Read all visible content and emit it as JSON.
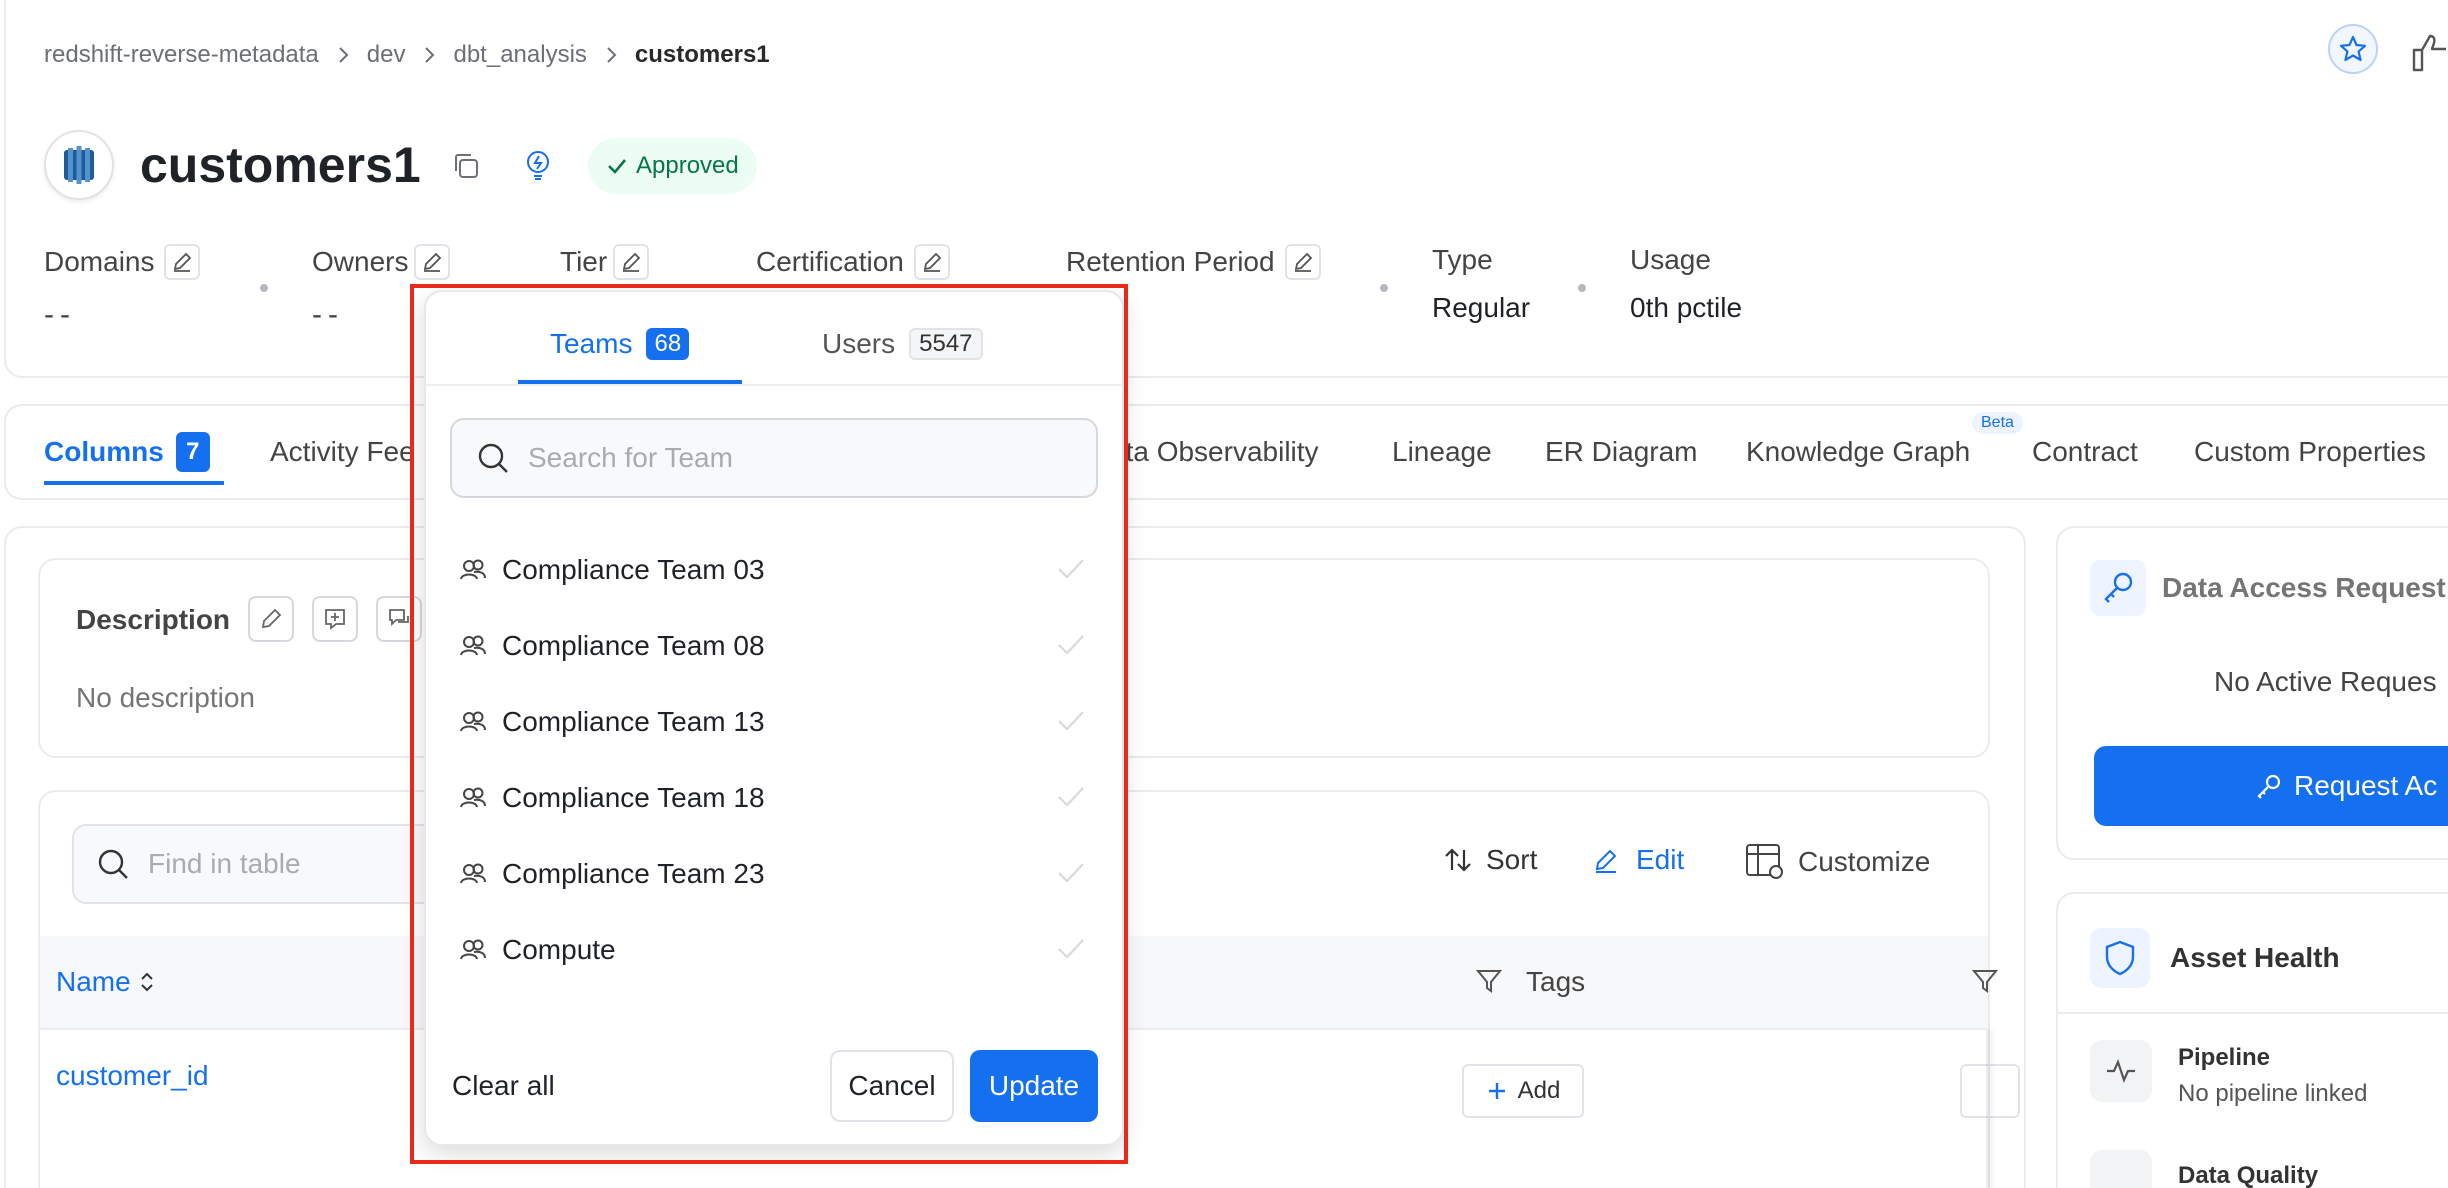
{
  "breadcrumb": [
    "redshift-reverse-metadata",
    "dev",
    "dbt_analysis",
    "customers1"
  ],
  "entity": {
    "title": "customers1",
    "status": "Approved"
  },
  "meta": [
    {
      "label": "Domains",
      "value": "--"
    },
    {
      "label": "Owners",
      "value": "--"
    },
    {
      "label": "Tier",
      "value": ""
    },
    {
      "label": "Certification",
      "value": ""
    },
    {
      "label": "Retention Period",
      "value": ""
    },
    {
      "label": "Type",
      "value": "Regular"
    },
    {
      "label": "Usage",
      "value": "0th pctile"
    }
  ],
  "tabs": [
    {
      "label": "Columns",
      "count": "7"
    },
    {
      "label": "Activity Fee"
    },
    {
      "label": "ata Observability"
    },
    {
      "label": "Lineage"
    },
    {
      "label": "ER Diagram"
    },
    {
      "label": "Knowledge Graph",
      "badge": "Beta"
    },
    {
      "label": "Contract"
    },
    {
      "label": "Custom Properties"
    }
  ],
  "description": {
    "title": "Description",
    "empty": "No description"
  },
  "table": {
    "search_placeholder": "Find in table",
    "sort": "Sort",
    "edit": "Edit",
    "customize": "Customize",
    "col_name": "Name",
    "col_tags": "Tags",
    "rows": [
      {
        "name": "customer_id",
        "add": "Add"
      }
    ]
  },
  "right": {
    "access_title": "Data Access Request",
    "access_empty": "No Active Reques",
    "access_button": "Request Ac",
    "health_title": "Asset Health",
    "pipeline_title": "Pipeline",
    "pipeline_sub": "No pipeline linked",
    "quality_title": "Data Quality"
  },
  "popup": {
    "tab_teams": "Teams",
    "teams_count": "68",
    "tab_users": "Users",
    "users_count": "5547",
    "search_placeholder": "Search for Team",
    "teams": [
      "Compliance Team 03",
      "Compliance Team 08",
      "Compliance Team 13",
      "Compliance Team 18",
      "Compliance Team 23",
      "Compute"
    ],
    "clear_all": "Clear all",
    "cancel": "Cancel",
    "update": "Update"
  },
  "colors": {
    "accent": "#1570ef",
    "highlight": "#e8291c",
    "approved_bg": "#ecfdf3",
    "approved_text": "#067647"
  }
}
